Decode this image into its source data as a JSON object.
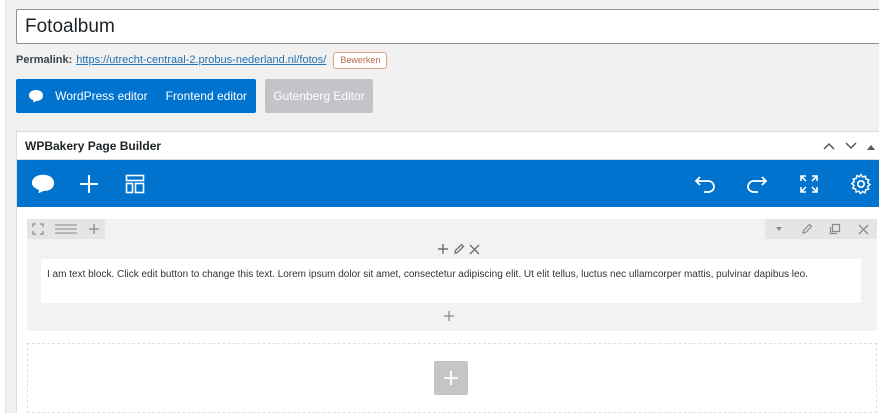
{
  "title": {
    "value": "Fotoalbum"
  },
  "permalink": {
    "label": "Permalink:",
    "url": "https://utrecht-centraal-2.probus-nederland.nl/fotos/",
    "edit_label": "Bewerken"
  },
  "editor_switch": {
    "wp_editor": "WordPress editor",
    "frontend_editor": "Frontend editor",
    "gutenberg": "Gutenberg Editor"
  },
  "panel": {
    "title": "WPBakery Page Builder"
  },
  "text_block": {
    "content": "I am text block. Click edit button to change this text. Lorem ipsum dolor sit amet, consectetur adipiscing elit. Ut elit tellus, luctus nec ullamcorper mattis, pulvinar dapibus leo."
  },
  "colors": {
    "accent": "#0073cf",
    "edit_border": "#e0a27b"
  }
}
